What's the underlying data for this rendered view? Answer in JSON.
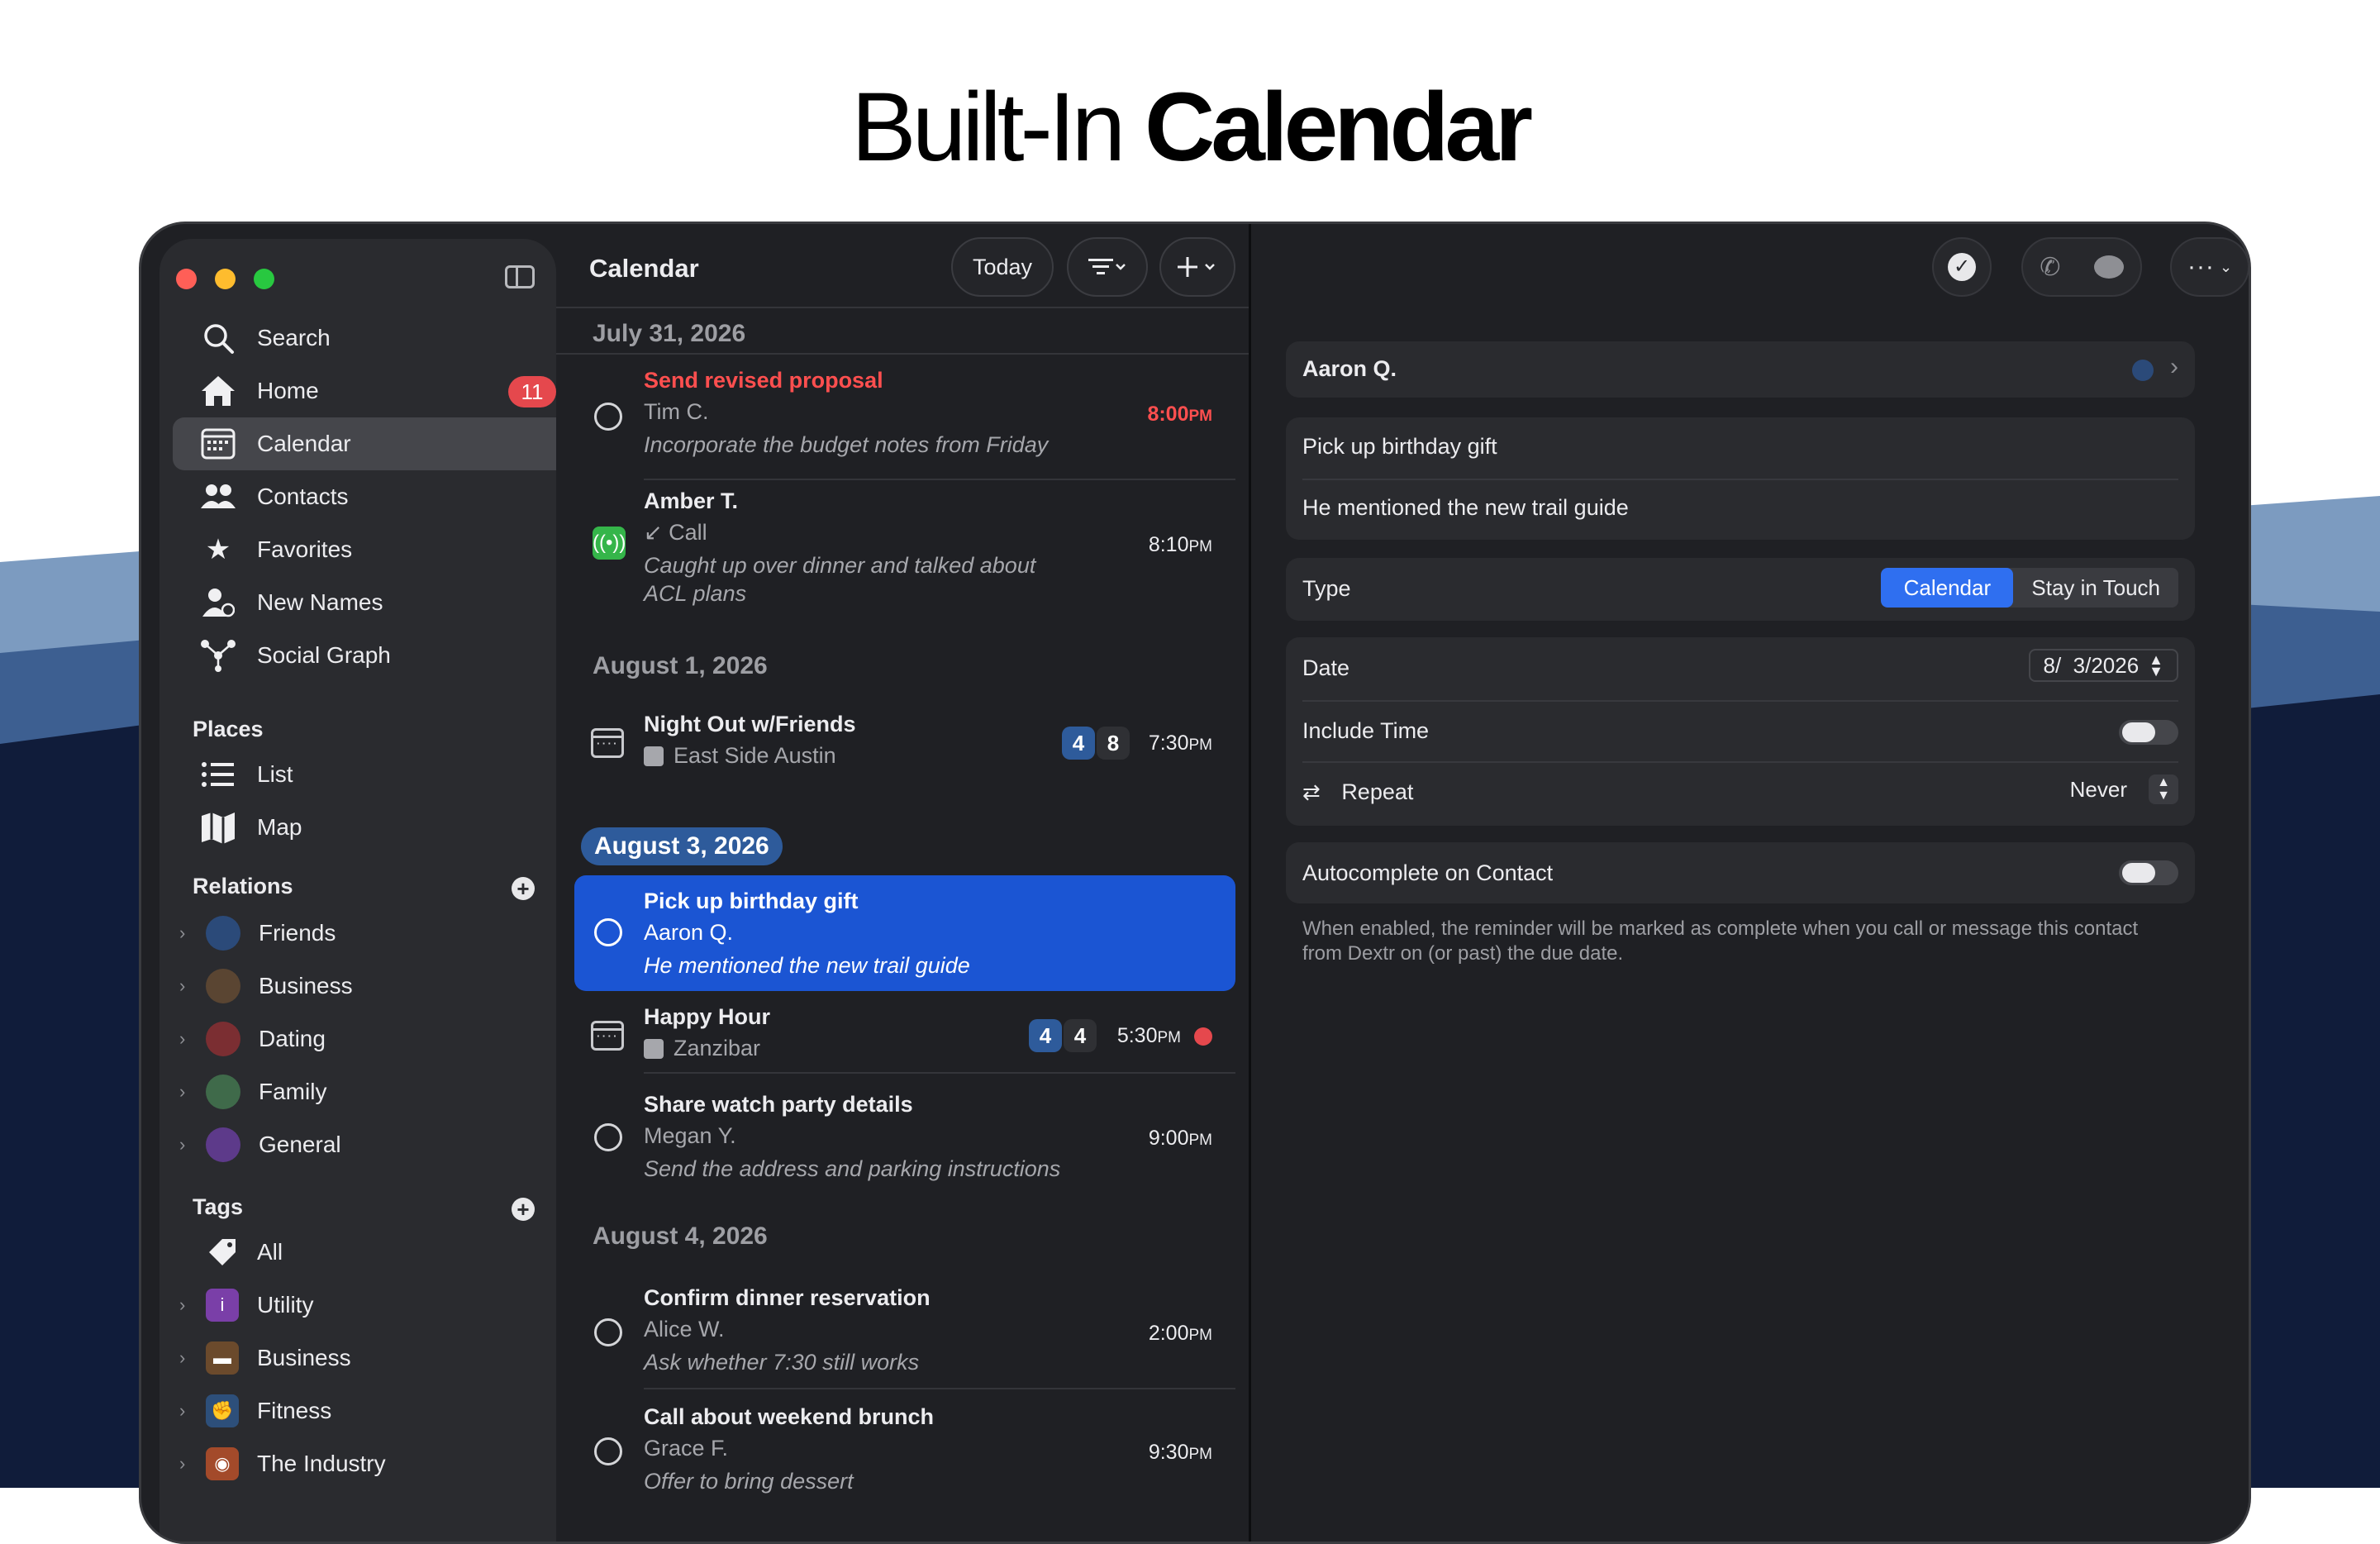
{
  "headline": {
    "light": "Built-In",
    "bold": "Calendar"
  },
  "colors": {
    "accent": "#2f6ff0",
    "selection": "#1b55d3",
    "danger": "#e5484d",
    "badge": "#e5484d"
  },
  "sidebar": {
    "items": [
      {
        "label": "Search",
        "icon": "search-icon"
      },
      {
        "label": "Home",
        "icon": "home-icon",
        "badge": "11"
      },
      {
        "label": "Calendar",
        "icon": "calendar-icon",
        "active": true
      },
      {
        "label": "Contacts",
        "icon": "contacts-icon"
      },
      {
        "label": "Favorites",
        "icon": "star-icon"
      },
      {
        "label": "New Names",
        "icon": "new-person-icon"
      },
      {
        "label": "Social Graph",
        "icon": "graph-icon"
      }
    ],
    "places_header": "Places",
    "places": [
      {
        "label": "List",
        "icon": "list-icon"
      },
      {
        "label": "Map",
        "icon": "map-icon"
      }
    ],
    "relations_header": "Relations",
    "relations": [
      {
        "label": "Friends",
        "color": "#2b4a79"
      },
      {
        "label": "Business",
        "color": "#5a4532"
      },
      {
        "label": "Dating",
        "color": "#7b2e32"
      },
      {
        "label": "Family",
        "color": "#3f6a4a"
      },
      {
        "label": "General",
        "color": "#5d3a8a"
      }
    ],
    "tags_header": "Tags",
    "tags": [
      {
        "label": "All",
        "icon": "tag-icon"
      },
      {
        "label": "Utility",
        "icon": "info-icon",
        "color": "#7a3fa8"
      },
      {
        "label": "Business",
        "icon": "briefcase-icon",
        "color": "#6b4a2c"
      },
      {
        "label": "Fitness",
        "icon": "flex-arm-icon",
        "color": "#2d4f7a"
      },
      {
        "label": "The Industry",
        "icon": "film-icon",
        "color": "#a34a2a"
      }
    ]
  },
  "middle": {
    "title": "Calendar",
    "today_label": "Today",
    "groups": [
      {
        "date": "July 31, 2026"
      },
      {
        "date": "August 1, 2026"
      },
      {
        "date": "August 3, 2026"
      },
      {
        "date": "August 4, 2026"
      }
    ],
    "entries": [
      {
        "title": "Send revised proposal",
        "person": "Tim C.",
        "note": "Incorporate the budget notes from Friday",
        "time": "8:00",
        "ampm": "PM"
      },
      {
        "title": "Amber T.",
        "person": "Call",
        "note": "Caught up over dinner and talked about ACL plans",
        "time": "8:10",
        "ampm": "PM"
      },
      {
        "title": "Night Out w/Friends",
        "person": "East Side Austin",
        "count_a": "4",
        "count_b": "8",
        "time": "7:30",
        "ampm": "PM"
      },
      {
        "title": "Pick up birthday gift",
        "person": "Aaron Q.",
        "note": "He mentioned the new trail guide"
      },
      {
        "title": "Happy Hour",
        "person": "Zanzibar",
        "count_a": "4",
        "count_b": "4",
        "time": "5:30",
        "ampm": "PM"
      },
      {
        "title": "Share watch party details",
        "person": "Megan Y.",
        "note": "Send the address and parking instructions",
        "time": "9:00",
        "ampm": "PM"
      },
      {
        "title": "Confirm dinner reservation",
        "person": "Alice W.",
        "note": "Ask whether 7:30 still works",
        "time": "2:00",
        "ampm": "PM"
      },
      {
        "title": "Call about weekend brunch",
        "person": "Grace F.",
        "note": "Offer to bring dessert",
        "time": "9:30",
        "ampm": "PM"
      }
    ]
  },
  "detail": {
    "contact": "Aaron Q.",
    "title": "Pick up birthday gift",
    "note": "He mentioned the new trail guide",
    "type_label": "Type",
    "type_options": [
      "Calendar",
      "Stay in Touch"
    ],
    "date_label": "Date",
    "date_value": "8/  3/2026",
    "include_time_label": "Include Time",
    "repeat_label": "Repeat",
    "repeat_value": "Never",
    "autocomplete_label": "Autocomplete on Contact",
    "help_text": "When enabled, the reminder will be marked as complete when you call or message this contact from Dextr on (or past) the due date."
  }
}
